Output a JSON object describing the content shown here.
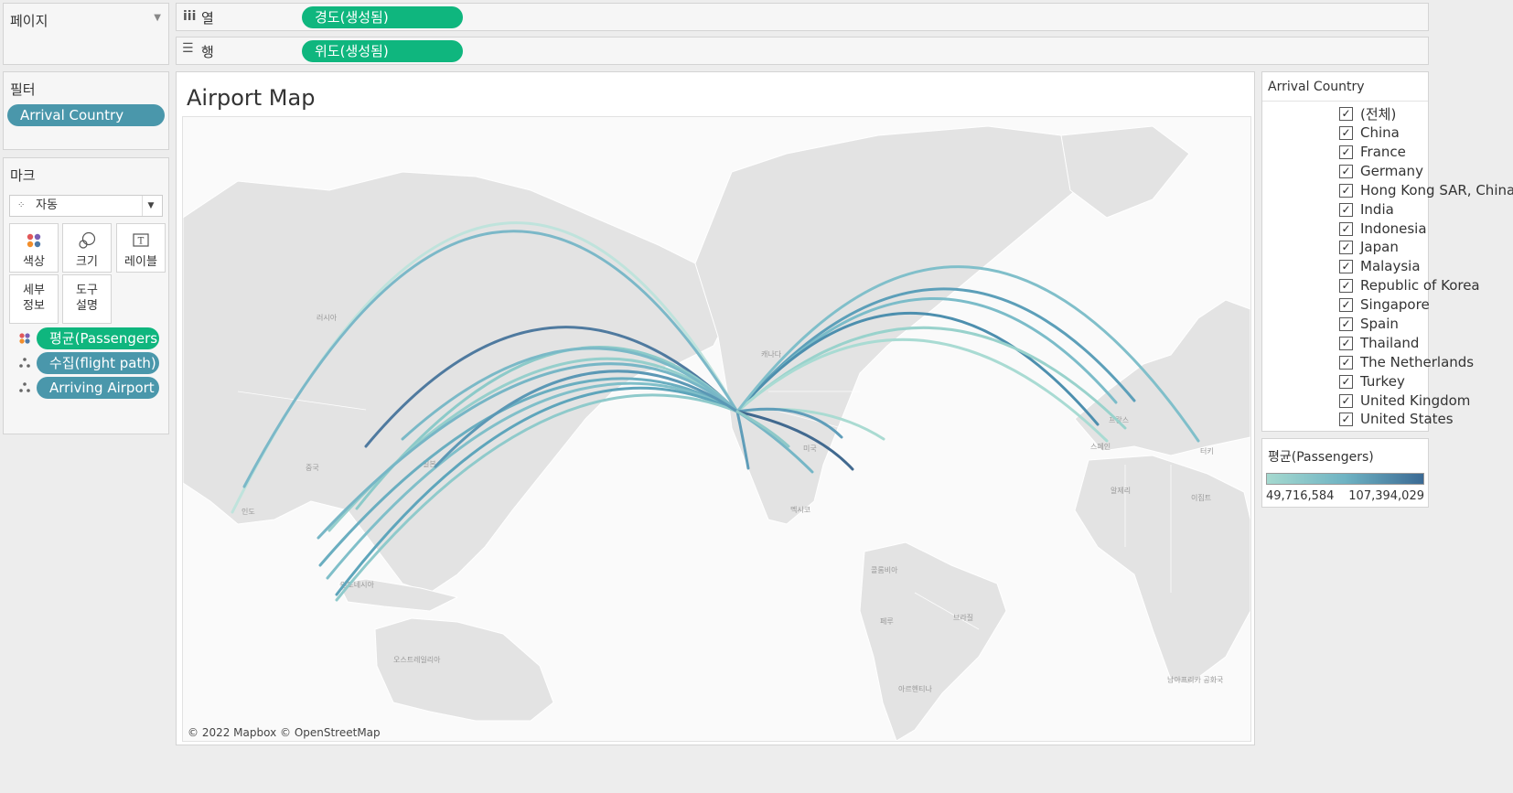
{
  "shelves": {
    "pages_label": "페이지",
    "columns_label": "열",
    "columns_pill": "경도(생성됨)",
    "rows_label": "행",
    "rows_pill": "위도(생성됨)"
  },
  "filters": {
    "title": "필터",
    "pills": [
      "Arrival Country"
    ]
  },
  "marks": {
    "title": "마크",
    "type_selected": "자동",
    "buttons": [
      "색상",
      "크기",
      "레이블",
      "세부\n정보",
      "도구\n설명"
    ],
    "pills": [
      {
        "label": "평균(Passengers)",
        "kind": "color",
        "color": "#0fb67e"
      },
      {
        "label": "수집(flight path)",
        "kind": "detail",
        "color": "#4a97ab"
      },
      {
        "label": "Arriving Airport",
        "kind": "detail",
        "color": "#4a97ab"
      }
    ]
  },
  "sheet": {
    "title": "Airport Map",
    "attribution": "© 2022 Mapbox © OpenStreetMap",
    "map_labels": [
      "러시아",
      "중국",
      "인도",
      "일본",
      "인도네시아",
      "오스트레일리아",
      "캐나다",
      "미국",
      "멕시코",
      "콜롬비아",
      "페루",
      "브라질",
      "아르헨티나",
      "프랑스",
      "스페인",
      "알제리",
      "이집트",
      "남아프리카 공화국",
      "터키"
    ]
  },
  "filter_card": {
    "title": "Arrival Country",
    "items": [
      "(전체)",
      "China",
      "France",
      "Germany",
      "Hong Kong SAR, China",
      "India",
      "Indonesia",
      "Japan",
      "Malaysia",
      "Republic of Korea",
      "Singapore",
      "Spain",
      "Thailand",
      "The Netherlands",
      "Turkey",
      "United Kingdom",
      "United States"
    ],
    "checked": true
  },
  "color_legend": {
    "title": "평균(Passengers)",
    "min_label": "49,716,584",
    "max_label": "107,394,029",
    "color_min": "#a5d9cf",
    "color_max": "#3b6a94"
  }
}
